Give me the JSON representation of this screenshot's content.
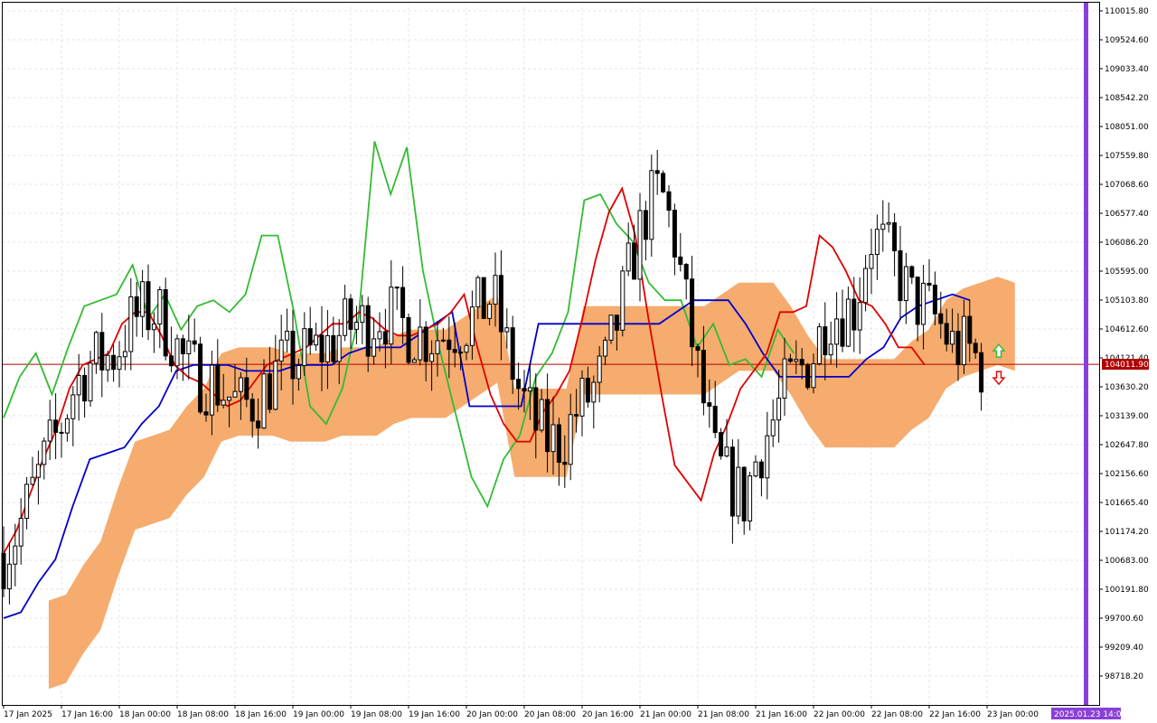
{
  "colors": {
    "background": "#ffffff",
    "grid": "#e6e6e6",
    "frame": "#000000",
    "tenkan": "#e00000",
    "kijun": "#0000cc",
    "chikou": "#33bb33",
    "kumo_bull": "#f4a35e",
    "kumo_bear": "#d4b8d8",
    "candle_bear": "#000000",
    "candle_bull": "#ffffff",
    "price_line": "#b00000",
    "price_badge": "#b00000",
    "time_marker": "#8a3fd8",
    "arrow_up": "#33bb33",
    "arrow_down": "#e00000"
  },
  "chart_data": {
    "type": "candlestick",
    "instrument_hint": "Ichimoku Kinko Hyo on hourly chart",
    "title": "",
    "ylim": [
      98400,
      110200
    ],
    "y_ticks": [
      "110015.80",
      "109524.60",
      "109033.40",
      "108542.20",
      "108051.00",
      "107559.80",
      "107068.60",
      "106577.40",
      "106086.20",
      "105595.00",
      "105103.80",
      "104612.60",
      "104121.40",
      "103630.20",
      "103139.00",
      "102647.80",
      "102156.60",
      "101665.40",
      "101174.20",
      "100683.00",
      "100191.80",
      "99700.60",
      "99209.40",
      "98718.20"
    ],
    "x_ticks": [
      "17 Jan 2025",
      "17 Jan 16:00",
      "18 Jan 00:00",
      "18 Jan 08:00",
      "18 Jan 16:00",
      "19 Jan 00:00",
      "19 Jan 08:00",
      "19 Jan 16:00",
      "20 Jan 00:00",
      "20 Jan 08:00",
      "20 Jan 16:00",
      "21 Jan 00:00",
      "21 Jan 08:00",
      "21 Jan 16:00",
      "22 Jan 00:00",
      "22 Jan 08:00",
      "22 Jan 16:00",
      "23 Jan 00:00"
    ],
    "current_price_label": "104011.90",
    "current_price": 104011.9,
    "time_marker_label": "2025.01.23 14:00",
    "signals": [
      {
        "type": "up",
        "label": "buy arrow"
      },
      {
        "type": "down",
        "label": "sell arrow"
      }
    ],
    "tenkan": [
      100800,
      101200,
      101800,
      102400,
      102900,
      103600,
      104000,
      104100,
      104200,
      104700,
      104900,
      104900,
      104500,
      104000,
      103800,
      103700,
      103500,
      103300,
      103400,
      103700,
      104000,
      104100,
      104200,
      104300,
      104500,
      104700,
      104700,
      104900,
      104800,
      104600,
      104500,
      104500,
      104600,
      104700,
      104900,
      105200,
      104300,
      103500,
      103000,
      102700,
      102700,
      103200,
      103500,
      103900,
      104800,
      105800,
      106600,
      107000,
      106200,
      104800,
      103500,
      102300,
      102000,
      101700,
      102500,
      103000,
      103600,
      103900,
      104200,
      104900,
      104900,
      105000,
      106200,
      106000,
      105600,
      105100,
      105000,
      104700,
      104300,
      104300,
      104000
    ],
    "kijun": [
      99700,
      99800,
      100300,
      100700,
      101600,
      102400,
      102500,
      102600,
      103000,
      103300,
      103900,
      104000,
      104000,
      104000,
      103900,
      103900,
      103900,
      104000,
      104000,
      104000,
      104200,
      104300,
      104300,
      104300,
      104500,
      104700,
      104900,
      103300,
      103300,
      103300,
      103300,
      104700,
      104700,
      104700,
      104700,
      104700,
      104700,
      104700,
      104700,
      104900,
      105100,
      105100,
      105100,
      104700,
      104200,
      103800,
      103800,
      103800,
      103800,
      103800,
      104100,
      104300,
      104800,
      105000,
      105100,
      105200,
      105100
    ],
    "chikou": [
      103100,
      103800,
      104200,
      103500,
      104300,
      105000,
      105100,
      105200,
      105700,
      104800,
      105200,
      104600,
      105000,
      105100,
      104900,
      105200,
      106200,
      106200,
      104900,
      103300,
      103000,
      103600,
      104800,
      107800,
      106900,
      107700,
      105600,
      104300,
      103200,
      102100,
      101600,
      102400,
      102800,
      103800,
      104200,
      104900,
      106800,
      106900,
      106400,
      106100,
      105400,
      105100,
      105100,
      104300,
      104700,
      104000,
      104100,
      103800,
      104600,
      104200
    ]
  }
}
